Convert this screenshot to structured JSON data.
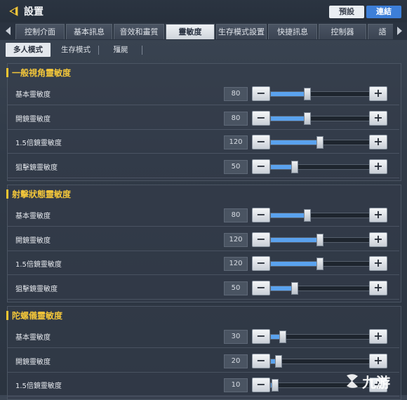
{
  "header": {
    "title": "設置",
    "preset_label": "預設",
    "connect_label": "連結"
  },
  "tabs": [
    {
      "label": "控制介面",
      "w": 68
    },
    {
      "label": "基本訊息",
      "w": 64
    },
    {
      "label": "音效和畫質",
      "w": 70
    },
    {
      "label": "靈敏度",
      "w": 68,
      "active": true
    },
    {
      "label": "生存模式設置",
      "w": 70
    },
    {
      "label": "快捷訊息",
      "w": 68
    },
    {
      "label": "控制器",
      "w": 66
    },
    {
      "label": "語",
      "w": 40
    }
  ],
  "subtabs": [
    "多人模式",
    "生存模式",
    "殭屍"
  ],
  "sections": [
    {
      "title": "一般視角靈敏度",
      "rows": [
        {
          "label": "基本靈敏度",
          "value": "80",
          "level": 0.37
        },
        {
          "label": "開鏡靈敏度",
          "value": "80",
          "level": 0.37
        },
        {
          "label": "1.5倍鏡靈敏度",
          "value": "120",
          "level": 0.5
        },
        {
          "label": "狙擊鏡靈敏度",
          "value": "50",
          "level": 0.24
        }
      ]
    },
    {
      "title": "射擊狀態靈敏度",
      "rows": [
        {
          "label": "基本靈敏度",
          "value": "80",
          "level": 0.37
        },
        {
          "label": "開鏡靈敏度",
          "value": "120",
          "level": 0.5
        },
        {
          "label": "1.5倍鏡靈敏度",
          "value": "120",
          "level": 0.5
        },
        {
          "label": "狙擊鏡靈敏度",
          "value": "50",
          "level": 0.24
        }
      ]
    },
    {
      "title": "陀螺儀靈敏度",
      "rows": [
        {
          "label": "基本靈敏度",
          "value": "30",
          "level": 0.12
        },
        {
          "label": "開鏡靈敏度",
          "value": "20",
          "level": 0.08
        },
        {
          "label": "1.5倍鏡靈敏度",
          "value": "10",
          "level": 0.04
        }
      ]
    }
  ],
  "controls": {
    "minus_glyph": "−",
    "plus_glyph": "+"
  },
  "watermark": {
    "text": "九游"
  },
  "colors": {
    "accent": "#f3c63a",
    "fill": "#5aa2ee",
    "connect": "#3d7fd8"
  }
}
